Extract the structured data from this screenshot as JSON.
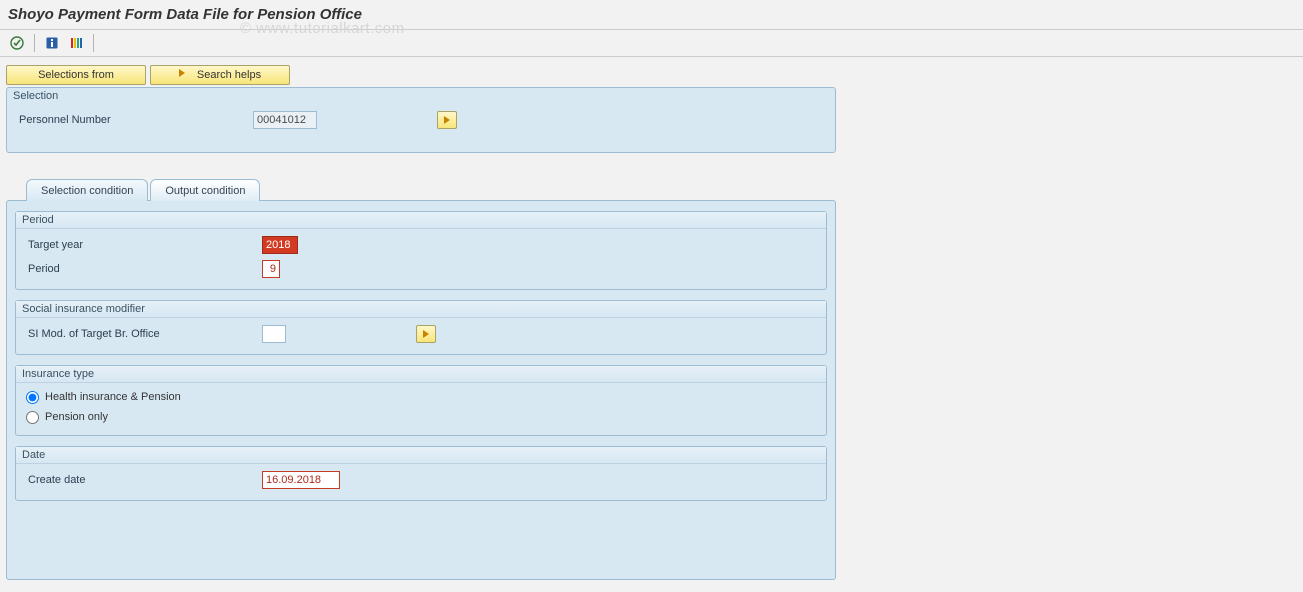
{
  "header": {
    "title": "Shoyo Payment Form Data File for Pension Office"
  },
  "watermark": "© www.tutorialkart.com",
  "toolbar_icons": {
    "execute": "execute-icon",
    "info": "info-icon",
    "variants": "variants-icon"
  },
  "buttons": {
    "selections_from": "Selections from",
    "search_helps": "Search helps"
  },
  "selection": {
    "group_title": "Selection",
    "personnel_number_label": "Personnel Number",
    "personnel_number_value": "00041012"
  },
  "tabs": {
    "selection_condition": "Selection condition",
    "output_condition": "Output condition"
  },
  "period": {
    "group_title": "Period",
    "target_year_label": "Target year",
    "target_year_value": "2018",
    "period_label": "Period",
    "period_value": "9"
  },
  "si_mod": {
    "group_title": "Social insurance modifier",
    "label": "SI Mod. of Target Br. Office",
    "value": ""
  },
  "insurance_type": {
    "group_title": "Insurance type",
    "opt_health_pension": "Health insurance & Pension",
    "opt_pension_only": "Pension only"
  },
  "date": {
    "group_title": "Date",
    "create_date_label": "Create date",
    "create_date_value": "16.09.2018"
  }
}
